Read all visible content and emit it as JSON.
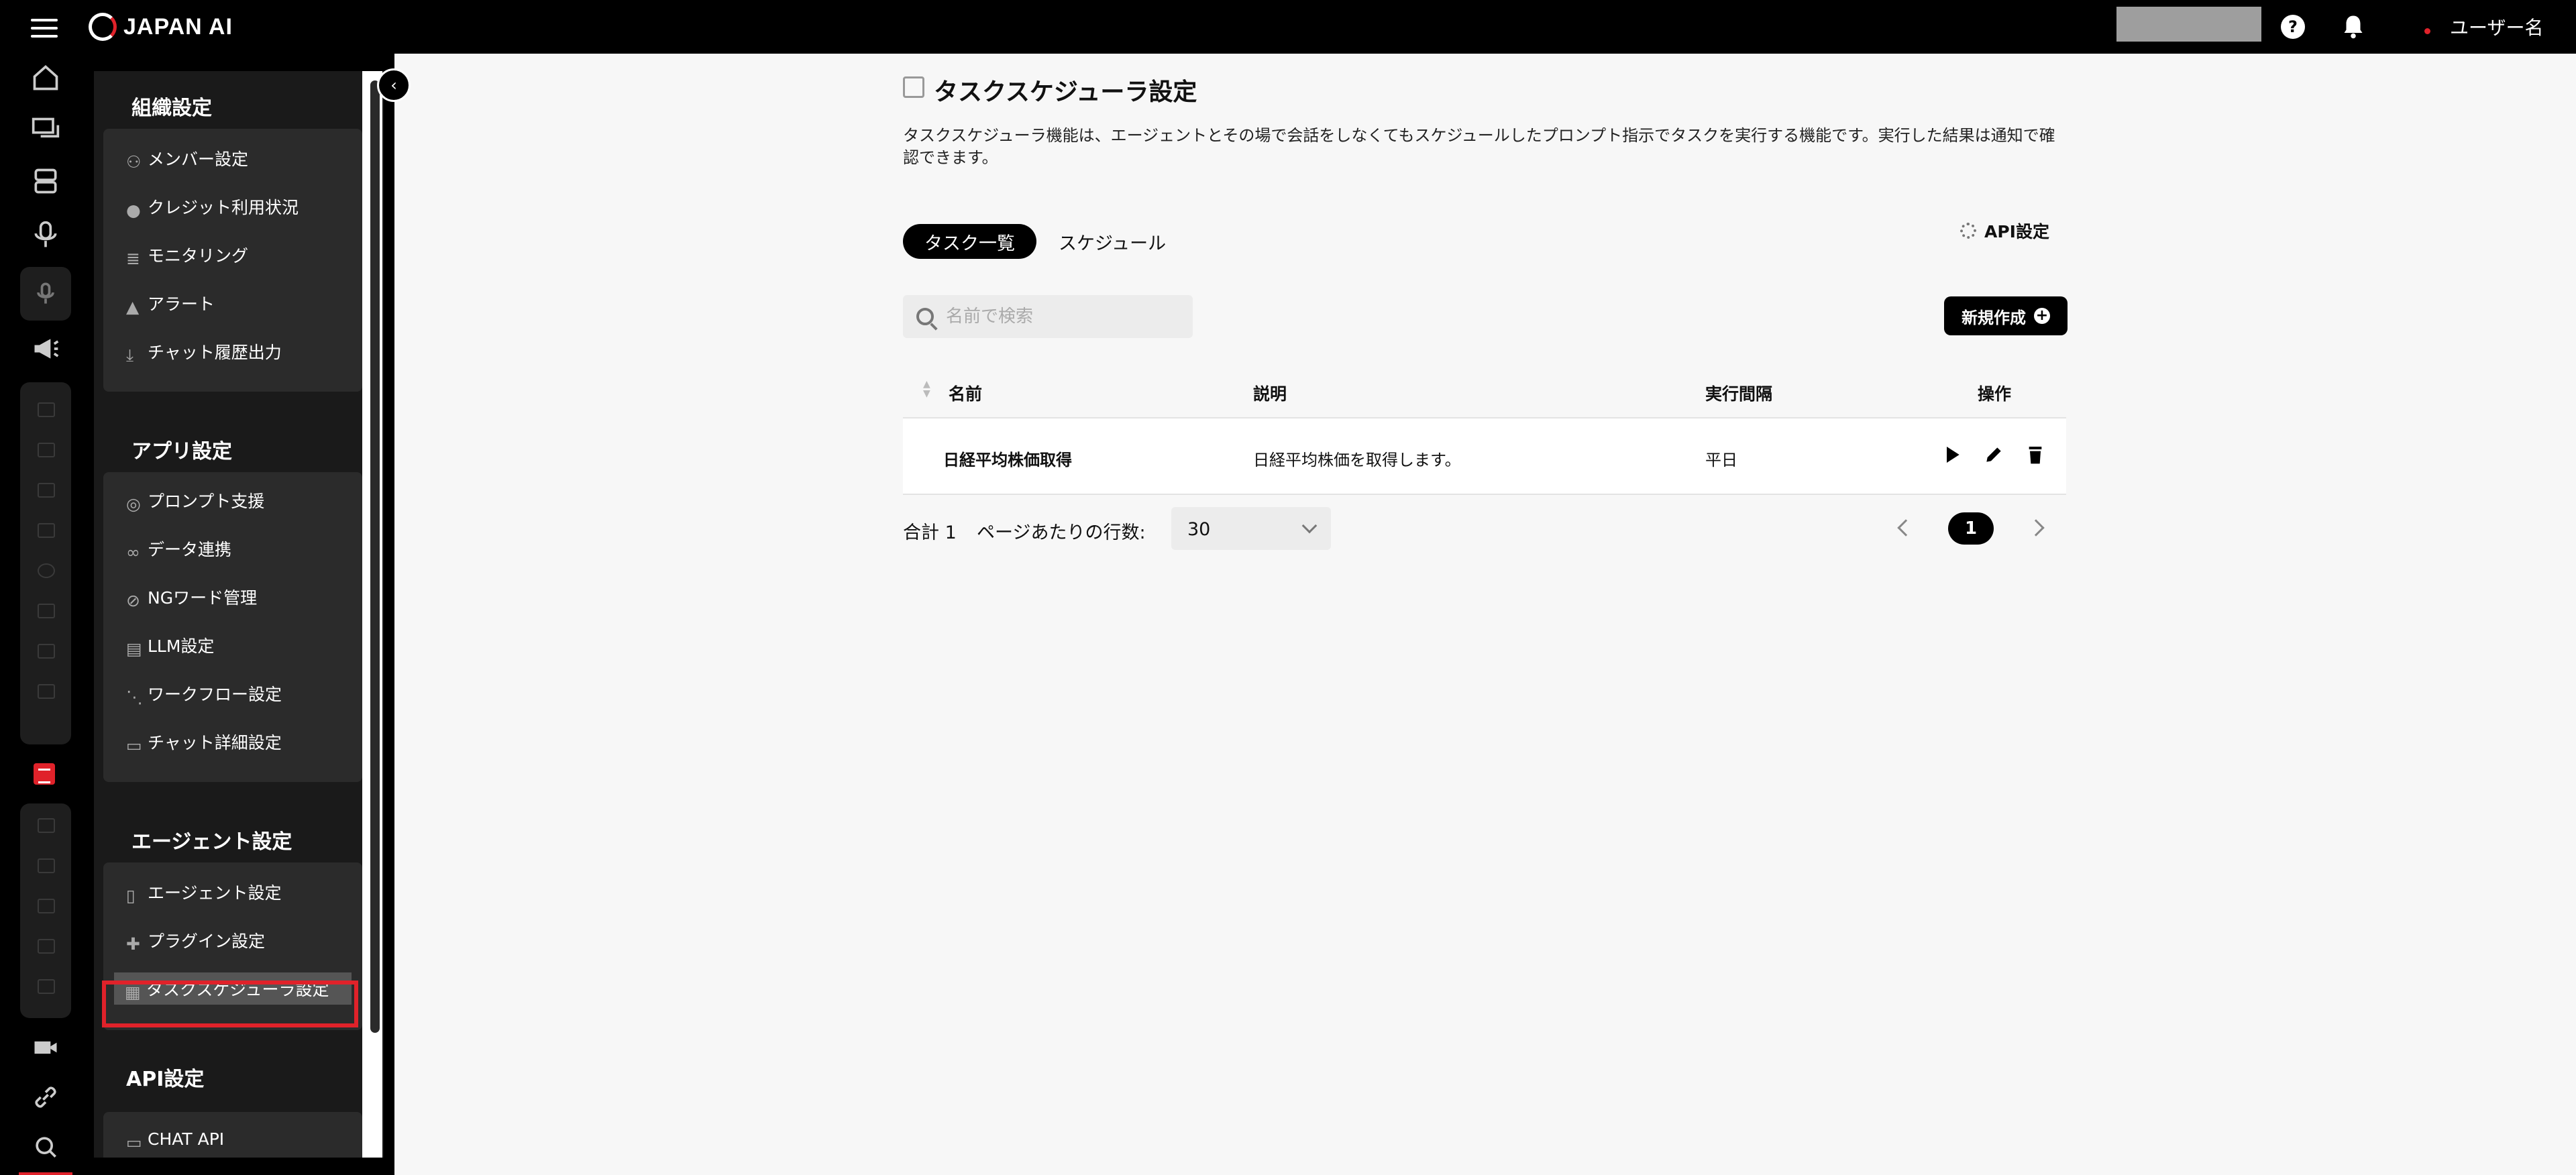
{
  "topbar": {
    "brand": "JAPAN AI",
    "help": "?",
    "user_name": "ユーザー名"
  },
  "settings_nav": {
    "sections": [
      {
        "title": "組織設定",
        "items": [
          "メンバー設定",
          "クレジット利用状況",
          "モニタリング",
          "アラート",
          "チャット履歴出力"
        ]
      },
      {
        "title": "アプリ設定",
        "items": [
          "プロンプト支援",
          "データ連携",
          "NGワード管理",
          "LLM設定",
          "ワークフロー設定",
          "チャット詳細設定"
        ]
      },
      {
        "title": "エージェント設定",
        "items": [
          "エージェント設定",
          "プラグイン設定",
          "タスクスケジューラ設定"
        ]
      },
      {
        "title": "API設定",
        "items": [
          "CHAT API"
        ]
      }
    ],
    "active_item": "タスクスケジューラ設定"
  },
  "main": {
    "title": "タスクスケジューラ設定",
    "description": "タスクスケジューラ機能は、エージェントとその場で会話をしなくてもスケジュールしたプロンプト指示でタスクを実行する機能です。実行した結果は通知で確認できます。",
    "tabs": [
      {
        "label": "タスク一覧",
        "active": true
      },
      {
        "label": "スケジュール",
        "active": false
      }
    ],
    "api_settings_label": "API設定",
    "search_placeholder": "名前で検索",
    "new_button_label": "新規作成",
    "table": {
      "headers": {
        "name": "名前",
        "description": "説明",
        "interval": "実行間隔",
        "actions": "操作"
      },
      "rows": [
        {
          "name": "日経平均株価取得",
          "description": "日経平均株価を取得します。",
          "interval": "平日"
        }
      ]
    },
    "footer": {
      "total": "合計 1",
      "rows_per_page_label": "ページあたりの行数:",
      "rows_per_page_value": "30",
      "current_page": "1"
    }
  },
  "colors": {
    "accent_red": "#e0222a",
    "sidebar_bg": "#000000",
    "content_bg": "#f7f7f7"
  }
}
